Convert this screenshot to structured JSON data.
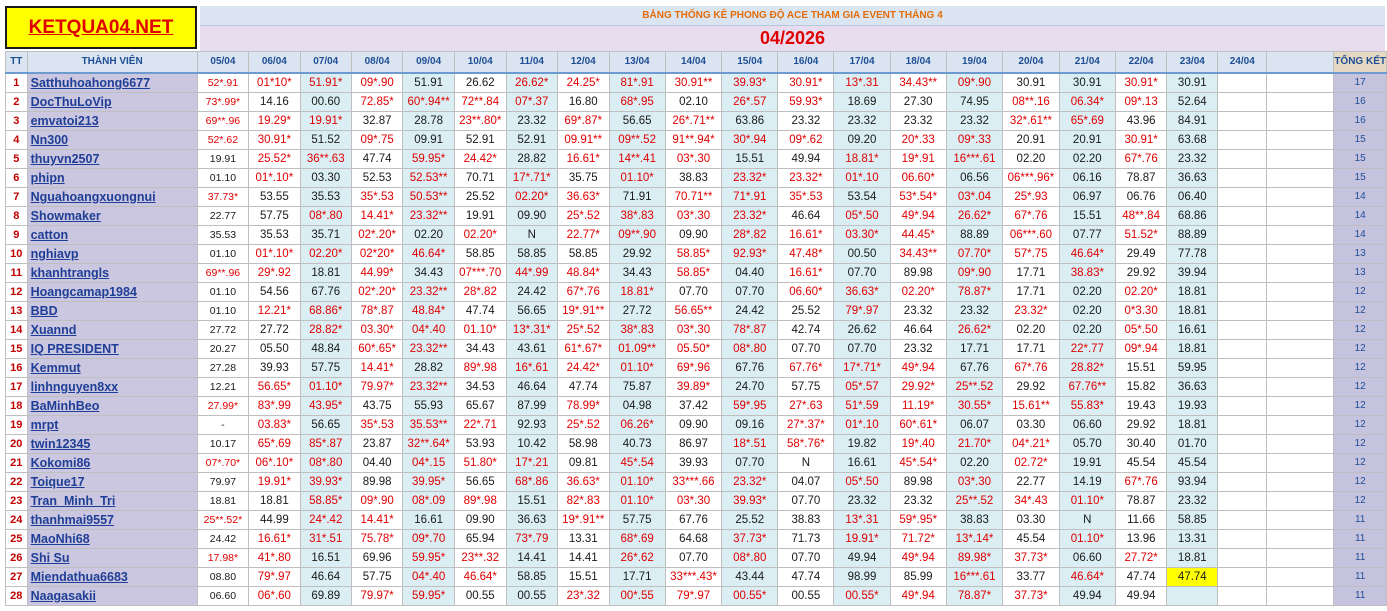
{
  "site_logo": "KETQUA04.NET",
  "title": "BẢNG THỐNG KÊ PHONG ĐỘ ACE THAM GIA EVENT THÁNG 4",
  "month": "04/2026",
  "headers": {
    "tt": "TT",
    "member": "THÀNH VIÊN",
    "summary": "TỔNG KẾT",
    "dates": [
      "05/04",
      "06/04",
      "07/04",
      "08/04",
      "09/04",
      "10/04",
      "11/04",
      "12/04",
      "13/04",
      "14/04",
      "15/04",
      "16/04",
      "17/04",
      "18/04",
      "19/04",
      "20/04",
      "21/04",
      "22/04",
      "23/04",
      "24/04"
    ]
  },
  "rows": [
    {
      "tt": "1",
      "name": "Satthuhoahong6677",
      "total": "17",
      "cells": [
        "52*.91",
        "01*10*",
        "51.91*",
        "09*.90",
        "51.91",
        "26.62",
        "26.62*",
        "24.25*",
        "81*.91",
        "30.91**",
        "39.93*",
        "30.91*",
        "13*.31",
        "34.43**",
        "09*.90",
        "30.91",
        "30.91",
        "30.91*",
        "30.91",
        ""
      ]
    },
    {
      "tt": "2",
      "name": "DocThuLoVip",
      "total": "16",
      "cells": [
        "73*.99*",
        "14.16",
        "00.60",
        "72.85*",
        "60*.94**",
        "72**.84",
        "07*.37",
        "16.80",
        "68*.95",
        "02.10",
        "26*.57",
        "59.93*",
        "18.69",
        "27.30",
        "74.95",
        "08**.16",
        "06.34*",
        "09*.13",
        "52.64",
        ""
      ]
    },
    {
      "tt": "3",
      "name": "emvatoi213",
      "total": "16",
      "cells": [
        "69**.96",
        "19.29*",
        "19.91*",
        "32.87",
        "28.78",
        "23**.80*",
        "23.32",
        "69*.87*",
        "56.65",
        "26*.71**",
        "63.86",
        "23.32",
        "23.32",
        "23.32",
        "23.32",
        "32*.61**",
        "65*.69",
        "43.96",
        "84.91",
        ""
      ]
    },
    {
      "tt": "4",
      "name": "Nn300",
      "total": "15",
      "cells": [
        "52*.62",
        "30.91*",
        "51.52",
        "09*.75",
        "09.91",
        "52.91",
        "52.91",
        "09.91**",
        "09**.52",
        "91**.94*",
        "30*.94",
        "09*.62",
        "09.20",
        "20*.33",
        "09*.33",
        "20.91",
        "20.91",
        "30.91*",
        "63.68",
        ""
      ]
    },
    {
      "tt": "5",
      "name": "thuyvn2507",
      "total": "15",
      "cells": [
        "19.91",
        "25.52*",
        "36**.63",
        "47.74",
        "59.95*",
        "24.42*",
        "28.82",
        "16.61*",
        "14**.41",
        "03*.30",
        "15.51",
        "49.94",
        "18.81*",
        "19*.91",
        "16***.61",
        "02.20",
        "02.20",
        "67*.76",
        "23.32",
        ""
      ]
    },
    {
      "tt": "6",
      "name": "phipn",
      "total": "15",
      "cells": [
        "01.10",
        "01*.10*",
        "03.30",
        "52.53",
        "52.53**",
        "70.71",
        "17*.71*",
        "35.75",
        "01.10*",
        "38.83",
        "23.32*",
        "23.32*",
        "01*.10",
        "06.60*",
        "06.56",
        "06***.96*",
        "06.16",
        "78.87",
        "36.63",
        ""
      ]
    },
    {
      "tt": "7",
      "name": "Nguahoangxuongnui",
      "total": "14",
      "cells": [
        "37.73*",
        "53.55",
        "35.53",
        "35*.53",
        "50.53**",
        "25.52",
        "02.20*",
        "36.63*",
        "71.91",
        "70.71**",
        "71*.91",
        "35*.53",
        "53.54",
        "53*.54*",
        "03*.04",
        "25*.93",
        "06.97",
        "06.76",
        "06.40",
        ""
      ]
    },
    {
      "tt": "8",
      "name": "Showmaker",
      "total": "14",
      "cells": [
        "22.77",
        "57.75",
        "08*.80",
        "14.41*",
        "23.32**",
        "19.91",
        "09.90",
        "25*.52",
        "38*.83",
        "03*.30",
        "23.32*",
        "46.64",
        "05*.50",
        "49*.94",
        "26.62*",
        "67*.76",
        "15.51",
        "48**.84",
        "68.86",
        ""
      ]
    },
    {
      "tt": "9",
      "name": "catton",
      "total": "14",
      "cells": [
        "35.53",
        "35.53",
        "35.71",
        "02*.20*",
        "02.20",
        "02.20*",
        "N",
        "22.77*",
        "09**.90",
        "09.90",
        "28*.82",
        "16.61*",
        "03.30*",
        "44.45*",
        "88.89",
        "06***.60",
        "07.77",
        "51.52*",
        "88.89",
        ""
      ]
    },
    {
      "tt": "10",
      "name": "nghiavp",
      "total": "13",
      "cells": [
        "01.10",
        "01*.10*",
        "02.20*",
        "02*20*",
        "46.64*",
        "58.85",
        "58.85",
        "58.85",
        "29.92",
        "58.85*",
        "92.93*",
        "47.48*",
        "00.50",
        "34.43**",
        "07.70*",
        "57*.75",
        "46.64*",
        "29.49",
        "77.78",
        ""
      ]
    },
    {
      "tt": "11",
      "name": "khanhtrangls",
      "total": "13",
      "cells": [
        "69**.96",
        "29*.92",
        "18.81",
        "44.99*",
        "34.43",
        "07***.70",
        "44*.99",
        "48.84*",
        "34.43",
        "58.85*",
        "04.40",
        "16.61*",
        "07.70",
        "89.98",
        "09*.90",
        "17.71",
        "38.83*",
        "29.92",
        "39.94",
        ""
      ]
    },
    {
      "tt": "12",
      "name": "Hoangcamap1984",
      "total": "12",
      "cells": [
        "01.10",
        "54.56",
        "67.76",
        "02*.20*",
        "23.32**",
        "28*.82",
        "24.42",
        "67*.76",
        "18.81*",
        "07.70",
        "07.70",
        "06.60*",
        "36.63*",
        "02.20*",
        "78.87*",
        "17.71",
        "02.20",
        "02.20*",
        "18.81",
        ""
      ]
    },
    {
      "tt": "13",
      "name": "BBD",
      "total": "12",
      "cells": [
        "01.10",
        "12.21*",
        "68.86*",
        "78*.87",
        "48.84*",
        "47.74",
        "56.65",
        "19*.91**",
        "27.72",
        "56.65**",
        "24.42",
        "25.52",
        "79*.97",
        "23.32",
        "23.32",
        "23.32*",
        "02.20",
        "0*3.30",
        "18.81",
        ""
      ]
    },
    {
      "tt": "14",
      "name": "Xuannd",
      "total": "12",
      "cells": [
        "27.72",
        "27.72",
        "28.82*",
        "03.30*",
        "04*.40",
        "01.10*",
        "13*.31*",
        "25*.52",
        "38*.83",
        "03*.30",
        "78*.87",
        "42.74",
        "26.62",
        "46.64",
        "26.62*",
        "02.20",
        "02.20",
        "05*.50",
        "16.61",
        ""
      ]
    },
    {
      "tt": "15",
      "name": "IQ PRESIDENT",
      "total": "12",
      "cells": [
        "20.27",
        "05.50",
        "48.84",
        "60*.65*",
        "23.32**",
        "34.43",
        "43.61",
        "61*.67*",
        "01.09**",
        "05.50*",
        "08*.80",
        "07.70",
        "07.70",
        "23.32",
        "17.71",
        "17.71",
        "22*.77",
        "09*.94",
        "18.81",
        ""
      ]
    },
    {
      "tt": "16",
      "name": "Kemmut",
      "total": "12",
      "cells": [
        "27.28",
        "39.93",
        "57.75",
        "14.41*",
        "28.82",
        "89*.98",
        "16*.61",
        "24.42*",
        "01.10*",
        "69*.96",
        "67.76",
        "67.76*",
        "17*.71*",
        "49*.94",
        "67.76",
        "67*.76",
        "28.82*",
        "15.51",
        "59.95",
        ""
      ]
    },
    {
      "tt": "17",
      "name": "linhnguyen8xx",
      "total": "12",
      "cells": [
        "12.21",
        "56.65*",
        "01.10*",
        "79.97*",
        "23.32**",
        "34.53",
        "46.64",
        "47.74",
        "75.87",
        "39.89*",
        "24.70",
        "57.75",
        "05*.57",
        "29.92*",
        "25**.52",
        "29.92",
        "67.76**",
        "15.82",
        "36.63",
        ""
      ]
    },
    {
      "tt": "18",
      "name": "BaMinhBeo",
      "total": "12",
      "cells": [
        "27.99*",
        "83*.99",
        "43.95*",
        "43.75",
        "55.93",
        "65.67",
        "87.99",
        "78.99*",
        "04.98",
        "37.42",
        "59*.95",
        "27*.63",
        "51*.59",
        "11.19*",
        "30.55*",
        "15.61**",
        "55.83*",
        "19.43",
        "19.93",
        ""
      ]
    },
    {
      "tt": "19",
      "name": "mrpt",
      "total": "12",
      "cells": [
        "-",
        "03.83*",
        "56.65",
        "35*.53",
        "35.53**",
        "22*.71",
        "92.93",
        "25*.52",
        "06.26*",
        "09.90",
        "09.16",
        "27*.37*",
        "01*.10",
        "60*.61*",
        "06.07",
        "03.30",
        "06.60",
        "29.92",
        "18.81",
        ""
      ]
    },
    {
      "tt": "20",
      "name": "twin12345",
      "total": "12",
      "cells": [
        "10.17",
        "65*.69",
        "85*.87",
        "23.87",
        "32**.64*",
        "53.93",
        "10.42",
        "58.98",
        "40.73",
        "86.97",
        "18*.51",
        "58*.76*",
        "19.82",
        "19*.40",
        "21.70*",
        "04*.21*",
        "05.70",
        "30.40",
        "01.70",
        ""
      ]
    },
    {
      "tt": "21",
      "name": "Kokomi86",
      "total": "12",
      "cells": [
        "07*.70*",
        "06*.10*",
        "08*.80",
        "04.40",
        "04*.15",
        "51.80*",
        "17*.21",
        "09.81",
        "45*.54",
        "39.93",
        "07.70",
        "N",
        "16.61",
        "45*.54*",
        "02.20",
        "02.72*",
        "19.91",
        "45.54",
        "45.54",
        ""
      ]
    },
    {
      "tt": "22",
      "name": "Toique17",
      "total": "12",
      "cells": [
        "79.97",
        "19.91*",
        "39.93*",
        "89.98",
        "39.95*",
        "56.65",
        "68*.86",
        "36.63*",
        "01.10*",
        "33***.66",
        "23.32*",
        "04.07",
        "05*.50",
        "89.98",
        "03*.30",
        "22.77",
        "14.19",
        "67*.76",
        "93.94",
        ""
      ]
    },
    {
      "tt": "23",
      "name": "Tran_Minh_Tri",
      "total": "12",
      "cells": [
        "18.81",
        "18.81",
        "58.85*",
        "09*.90",
        "08*.09",
        "89*.98",
        "15.51",
        "82*.83",
        "01.10*",
        "03*.30",
        "39.93*",
        "07.70",
        "23.32",
        "23.32",
        "25**.52",
        "34*.43",
        "01.10*",
        "78.87",
        "23.32",
        ""
      ]
    },
    {
      "tt": "24",
      "name": "thanhmai9557",
      "total": "11",
      "cells": [
        "25**.52*",
        "44.99",
        "24*.42",
        "14.41*",
        "16.61",
        "09.90",
        "36.63",
        "19*.91**",
        "57.75",
        "67.76",
        "25.52",
        "38.83",
        "13*.31",
        "59*.95*",
        "38.83",
        "03.30",
        "N",
        "11.66",
        "58.85",
        ""
      ]
    },
    {
      "tt": "25",
      "name": "MaoNhi68",
      "total": "11",
      "cells": [
        "24.42",
        "16.61*",
        "31*.51",
        "75.78*",
        "09*.70",
        "65.94",
        "73*.79",
        "13.31",
        "68*.69",
        "64.68",
        "37.73*",
        "71.73",
        "19.91*",
        "71.72*",
        "13*.14*",
        "45.54",
        "01.10*",
        "13.96",
        "13.31",
        ""
      ]
    },
    {
      "tt": "26",
      "name": "Shi Su",
      "total": "11",
      "cells": [
        "17.98*",
        "41*.80",
        "16.51",
        "69.96",
        "59.95*",
        "23**.32",
        "14.41",
        "14.41",
        "26*.62",
        "07.70",
        "08*.80",
        "07.70",
        "49.94",
        "49*.94",
        "89.98*",
        "37.73*",
        "06.60",
        "27.72*",
        "18.81",
        ""
      ]
    },
    {
      "tt": "27",
      "name": "Miendathua6683",
      "total": "11",
      "cells": [
        "08.80",
        "79*.97",
        "46.64",
        "57.75",
        "04*.40",
        "46.64*",
        "58.85",
        "15.51",
        "17.71",
        "33***.43*",
        "43.44",
        "47.74",
        "98.99",
        "85.99",
        "16***.61",
        "33.77",
        "46.64*",
        "47.74",
        "47.74",
        ""
      ]
    },
    {
      "tt": "28",
      "name": "Naagasakii",
      "total": "11",
      "cells": [
        "06.60",
        "06*.60",
        "69.89",
        "79.97*",
        "59.95*",
        "00.55",
        "00.55",
        "23*.32",
        "00*.55",
        "79*.97",
        "00.55*",
        "00.55",
        "00.55*",
        "49*.94",
        "78.87*",
        "37.73*",
        "49.94",
        "49.94",
        "",
        ""
      ]
    }
  ],
  "highlight_cell": {
    "row": "27",
    "date": "23/04"
  },
  "colors": {
    "logo_bg": "#ffff00",
    "logo_text": "#e00000",
    "title_text": "#e46c0a",
    "month_text": "#e00000",
    "name_bg": "#cbc7e0",
    "win_text": "#e00000"
  }
}
